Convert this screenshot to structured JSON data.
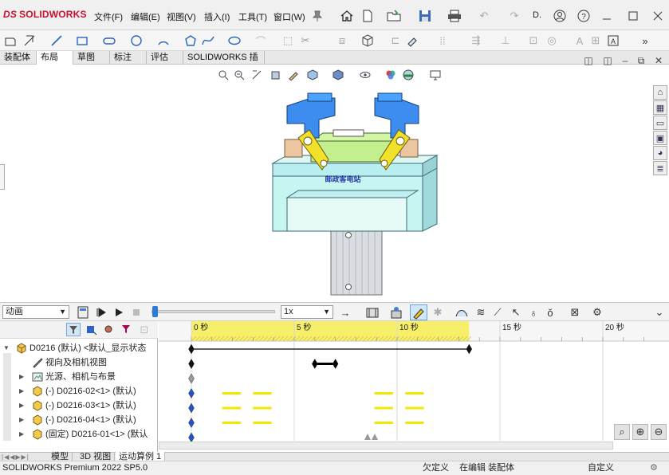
{
  "app": {
    "logo_prefix": "DS",
    "logo_text": "SOLIDWORKS",
    "menus": [
      "文件(F)",
      "编辑(E)",
      "视图(V)",
      "插入(I)",
      "工具(T)",
      "窗口(W)"
    ],
    "doc_short": "D."
  },
  "command_tabs": [
    "装配体",
    "布局",
    "草图",
    "标注",
    "评估",
    "SOLIDWORKS 插件"
  ],
  "command_tabs_active": 1,
  "model_label": "邮政客电站",
  "motion": {
    "study_type": "动画",
    "playback_speed": "1x"
  },
  "tree": {
    "items": [
      {
        "label": "D0216 (默认) <默认_显示状态",
        "level": 0,
        "expand": "▼",
        "icon": "assembly-icon"
      },
      {
        "label": "视向及相机视图",
        "level": 1,
        "expand": "",
        "icon": "camera-icon"
      },
      {
        "label": "光源、相机与布景",
        "level": 1,
        "expand": "▶",
        "icon": "lights-icon"
      },
      {
        "label": "(-) D0216-02<1> (默认)",
        "level": 1,
        "expand": "▶",
        "icon": "part-icon"
      },
      {
        "label": "(-) D0216-03<1> (默认)",
        "level": 1,
        "expand": "▶",
        "icon": "part-icon"
      },
      {
        "label": "(-) D0216-04<1> (默认)",
        "level": 1,
        "expand": "▶",
        "icon": "part-icon"
      },
      {
        "label": "(固定) D0216-01<1> (默认",
        "level": 1,
        "expand": "▶",
        "icon": "part-icon"
      }
    ]
  },
  "timeline": {
    "ticks": [
      {
        "label": "0 秒",
        "t": 0
      },
      {
        "label": "5 秒",
        "t": 5
      },
      {
        "label": "10 秒",
        "t": 10
      },
      {
        "label": "15 秒",
        "t": 15
      },
      {
        "label": "20 秒",
        "t": 20
      }
    ],
    "end_time": 13.5
  },
  "bottom_tabs": [
    "模型",
    "3D 视图",
    "运动算例 1"
  ],
  "bottom_tabs_active": 2,
  "status": {
    "version": "SOLIDWORKS Premium 2022 SP5.0",
    "under_defined": "欠定义",
    "editing": "在编辑 装配体",
    "custom": "自定义"
  },
  "colors": {
    "brand": "#c8102e",
    "timeline_yellow": "#f7ef6a",
    "keyframe_blue": "#2255cc"
  }
}
